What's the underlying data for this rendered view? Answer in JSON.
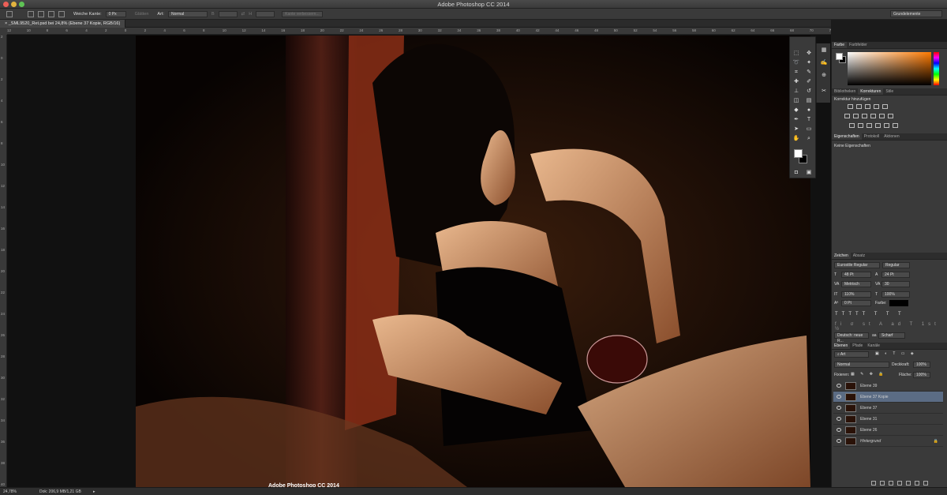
{
  "window": {
    "title": "Adobe Photoshop CC 2014"
  },
  "options": {
    "feather_label": "Weiche Kante:",
    "feather_value": "0 Px",
    "smooth_label": "Glätten",
    "style_label": "Art:",
    "style_value": "Normal",
    "width_label": "B",
    "height_label": "H",
    "refine_edge_label": "Kante verbessern...",
    "workspace": "Grundelemente"
  },
  "document": {
    "tab_title": "_SML9520_Ret.psd bei 24,8% (Ebene 37 Kopie, RGB/16)"
  },
  "ruler": {
    "h_ticks": [
      "12",
      "10",
      "8",
      "6",
      "4",
      "2",
      "0",
      "2",
      "4",
      "6",
      "8",
      "10",
      "12",
      "14",
      "16",
      "18",
      "20",
      "22",
      "24",
      "26",
      "28",
      "30",
      "32",
      "34",
      "36",
      "38",
      "40",
      "42",
      "44",
      "46",
      "48",
      "50",
      "52",
      "54",
      "56",
      "58",
      "60",
      "62",
      "64",
      "66",
      "68",
      "70",
      "72"
    ],
    "v_ticks": [
      "2",
      "0",
      "2",
      "4",
      "6",
      "8",
      "10",
      "12",
      "14",
      "16",
      "18",
      "20",
      "22",
      "24",
      "26",
      "28",
      "30",
      "32",
      "34",
      "36",
      "38",
      "40"
    ]
  },
  "color_panel": {
    "tabs": [
      "Farbe",
      "Farbfelder"
    ],
    "fg_color": "#ffffff",
    "bg_color": "#000000"
  },
  "adjustments_panel": {
    "tabs": [
      "Bibliotheken",
      "Korrekturen",
      "Stile"
    ],
    "header": "Korrektur hinzufügen"
  },
  "properties_panel": {
    "tabs": [
      "Eigenschaften",
      "Protokoll",
      "Aktionen"
    ],
    "empty_text": "Keine Eigenschaften"
  },
  "character_panel": {
    "tabs": [
      "Zeichen",
      "Absatz"
    ],
    "font_family": "Eurostile Regular",
    "font_style": "Regular",
    "font_size": "48 Pt",
    "leading": "24 Pt",
    "kerning": "Metrisch",
    "tracking": "30",
    "vertical_scale": "110%",
    "horizontal_scale": "100%",
    "baseline_shift": "0 Pt",
    "color_label": "Farbe:",
    "color": "#000000",
    "language": "Deutsch: neue R...",
    "antialias_label": "aa",
    "antialias": "Scharf"
  },
  "layers_panel": {
    "tabs": [
      "Ebenen",
      "Pfade",
      "Kanäle"
    ],
    "filter": "Art",
    "blend_mode": "Normal",
    "opacity_label": "Deckkraft:",
    "opacity": "100%",
    "lock_label": "Fixieren:",
    "fill_label": "Fläche:",
    "fill": "100%",
    "layers": [
      {
        "name": "Ebene 39",
        "selected": false
      },
      {
        "name": "Ebene 37 Kopie",
        "selected": true
      },
      {
        "name": "Ebene 37",
        "selected": false
      },
      {
        "name": "Ebene 31",
        "selected": false
      },
      {
        "name": "Ebene 26",
        "selected": false
      },
      {
        "name": "Hintergrund",
        "selected": false
      }
    ]
  },
  "status": {
    "zoom": "24,78%",
    "doc_size": "Dok: 206,9 MB/1,21 GB"
  },
  "overlay": {
    "watermark": "Adobe Photoshop CC 2014"
  }
}
